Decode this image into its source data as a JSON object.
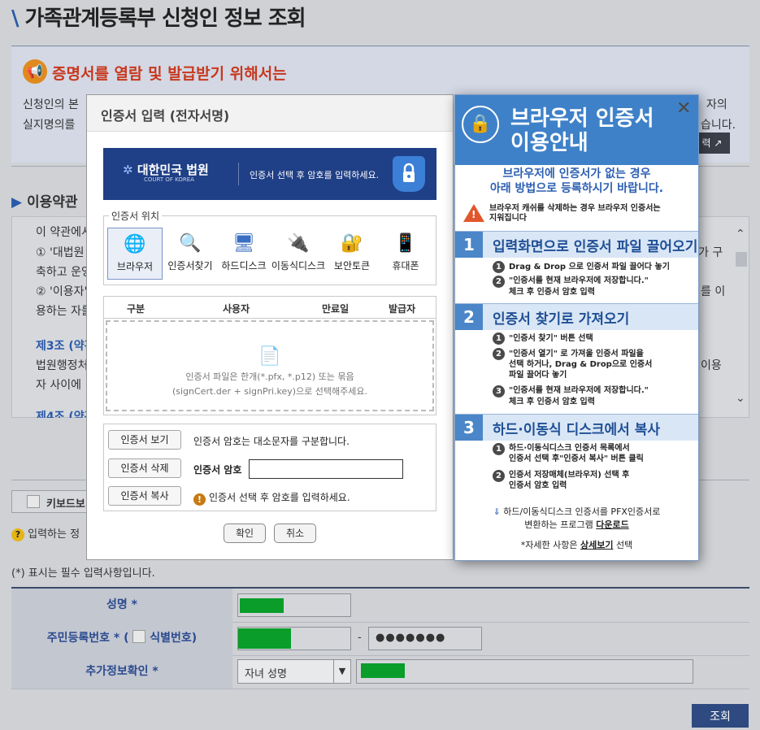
{
  "page": {
    "title": "가족관계등록부 신청인 정보 조회",
    "notice_title": "증명서를 열람 및 발급받기 위해서는",
    "notice_line1": "신청인의 본",
    "notice_line1_end": "자의",
    "notice_line2": "실지명의를",
    "notice_line2_end": "습니다.",
    "notice_button": "력",
    "terms_title": "이용약관",
    "terms_lines": [
      "이 약관에서",
      "① '대법원",
      "축하고 운영",
      "② '이용자'",
      "용하는 자를"
    ],
    "terms_right": [
      "가 구",
      "",
      "를 이",
      "",
      "이용"
    ],
    "terms_article3": "제3조 (약관",
    "terms_line6": "법원행정처",
    "terms_line7": "자 사이에 ",
    "terms_article4": "제4조 (약관",
    "keyboard_label": "키보드보",
    "help_text": "입력하는 정",
    "required_note": "(*) 표시는 필수 입력사항입니다.",
    "row_name": "성명 *",
    "row_rrn": "주민등록번호 * (",
    "row_rrn_after": "식별번호)",
    "row_extra": "추가정보확인 *",
    "select_value": "자녀 성명",
    "rrn_dash": "-",
    "rrn_mask": "●●●●●●●",
    "lookup_button": "조회"
  },
  "left_modal": {
    "title": "인증서 입력 (전자서명)",
    "banner_org": "대한민국 법원",
    "banner_org_en": "COURT OF KOREA",
    "banner_text": "인증서 선택 후 암호를 입력하세요.",
    "location_legend": "인증서 위치",
    "locations": [
      "브라우저",
      "인증서찾기",
      "하드디스크",
      "이동식디스크",
      "보안토큰",
      "휴대폰"
    ],
    "table_headers": [
      "구분",
      "사용자",
      "만료일",
      "발급자"
    ],
    "drop_text1": "인증서 파일은 한개(*.pfx, *.p12) 또는 묶음",
    "drop_text2": "(signCert.der + signPri.key)으로 선택해주세요.",
    "btn_view": "인증서 보기",
    "btn_delete": "인증서 삭제",
    "btn_copy": "인증서 복사",
    "case_note": "인증서 암호는 대소문자를 구분합니다.",
    "pwd_label": "인증서 암호",
    "pwd_hint": "인증서 선택 후 암호를 입력하세요.",
    "ok": "확인",
    "cancel": "취소"
  },
  "right_modal": {
    "title_line1": "브라우저 인증서",
    "title_line2": "이용안내",
    "lead1": "브라우저에 인증서가 없는 경우",
    "lead2": "아래 방법으로 등록하시기 바랍니다.",
    "warn1": "브라우저 캐쉬를 삭제하는 경우 브라우저 인증서는",
    "warn2": "지워집니다",
    "step1_title": "입력화면으로 인증서 파일 끌어오기",
    "step1_items": [
      "Drag & Drop 으로 인증서 파일 끌어다 놓기",
      "\"인증서를 현재 브라우저에 저장합니다.\"",
      "체크 후 인증서 암호 입력"
    ],
    "step2_title": "인증서 찾기로 가져오기",
    "step2_items": [
      "\"인증서 찾기\" 버튼 선택",
      "\"인증서 열기\" 로 가져올 인증서 파일을",
      "선택 하거나, Drag & Drop으로 인증서",
      "파일 끌어다 놓기",
      "\"인증서를 현재 브라우저에 저장합니다.\"",
      "체크 후 인증서 암호 입력"
    ],
    "step3_title": "하드·이동식 디스크에서 복사",
    "step3_items": [
      "하드·이동식디스크 인증서 목록에서",
      "인증서 선택 후\"인증서 복사\" 버튼 클릭",
      "인증서 저장매체(브라우저) 선택 후",
      "인증서 암호 입력"
    ],
    "foot1": "하드/이동식디스크 인증서를 PFX인증서로",
    "foot2": "변환하는 프로그램 ",
    "foot2_link": "다운로드",
    "foot3": "*자세한 사항은 ",
    "foot3_link": "상세보기",
    "foot3_end": " 선택"
  },
  "colors": {
    "accent": "#1f3f86",
    "guide_blue": "#3e81c8",
    "notice_red": "#c8381e",
    "masked_field": "#0a9d2a"
  }
}
